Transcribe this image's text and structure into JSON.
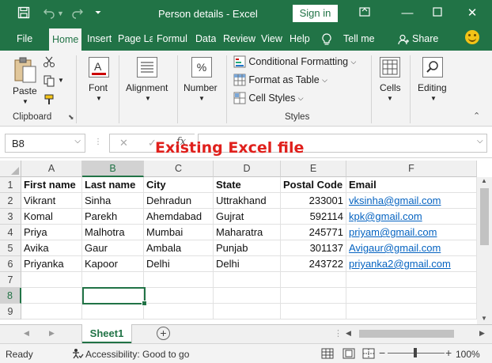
{
  "titlebar": {
    "title": "Person details  -  Excel",
    "signin": "Sign in",
    "save_icon": "save-icon",
    "undo_icon": "undo-icon",
    "redo_icon": "redo-icon",
    "customize_icon": "customize-qat-icon"
  },
  "tabs": {
    "file": "File",
    "home": "Home",
    "insert": "Insert",
    "page_layout": "Page La",
    "formulas": "Formul",
    "data": "Data",
    "review": "Review",
    "view": "View",
    "help": "Help",
    "tell_me": "Tell me",
    "share": "Share"
  },
  "ribbon": {
    "paste": "Paste",
    "clipboard": "Clipboard",
    "font": "Font",
    "alignment": "Alignment",
    "number": "Number",
    "number_symbol": "%",
    "conditional_formatting": "Conditional Formatting",
    "format_as_table": "Format as Table",
    "cell_styles": "Cell Styles",
    "styles": "Styles",
    "cells": "Cells",
    "editing": "Editing"
  },
  "formula_bar": {
    "name_box": "B8",
    "fx": "fx",
    "value": ""
  },
  "overlay_title": "Existing Excel file",
  "sheet": {
    "columns": [
      "A",
      "B",
      "C",
      "D",
      "E",
      "F"
    ],
    "rows": [
      "1",
      "2",
      "3",
      "4",
      "5",
      "6",
      "7",
      "8",
      "9"
    ],
    "header": [
      "First name",
      "Last name",
      "City",
      "State",
      "Postal Code",
      "Email"
    ],
    "data": [
      [
        "Vikrant",
        "Sinha",
        "Dehradun",
        "Uttrakhand",
        "233001",
        "vksinha@gmail.com"
      ],
      [
        "Komal",
        "Parekh",
        "Ahemdabad",
        "Gujrat",
        "592114",
        "kpk@gmail.com"
      ],
      [
        "Priya",
        "Malhotra",
        "Mumbai",
        "Maharatra",
        "245771",
        "priyam@gmail.com"
      ],
      [
        "Avika",
        "Gaur",
        "Ambala",
        "Punjab",
        "301137",
        "Avigaur@gmail.com"
      ],
      [
        "Priyanka",
        "Kapoor",
        "Delhi",
        "Delhi",
        "243722",
        "priyanka2@gmail.com"
      ]
    ],
    "selected_cell": "B8"
  },
  "sheet_tabs": {
    "active": "Sheet1"
  },
  "status": {
    "ready": "Ready",
    "accessibility": "Accessibility: Good to go",
    "zoom": "100%"
  },
  "colors": {
    "brand": "#217346",
    "link": "#0563c1",
    "overlay": "#e0201c"
  }
}
